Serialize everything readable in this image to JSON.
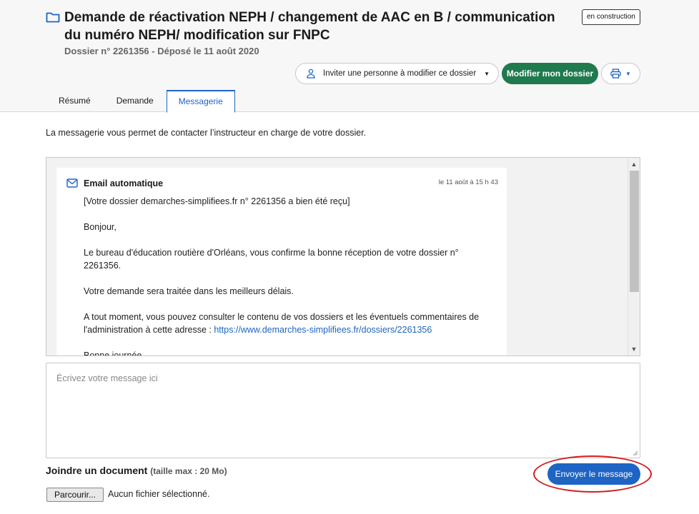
{
  "dossier": {
    "title": "Demande de réactivation NEPH / changement de AAC en B / communication du numéro NEPH/ modification sur FNPC",
    "subtitle": "Dossier n° 2261356 - Déposé le 11 août 2020",
    "status_badge": "en construction"
  },
  "actions": {
    "invite_label": "Inviter une personne à modifier ce dossier",
    "modify_label": "Modifier mon dossier"
  },
  "tabs": [
    {
      "label": "Résumé"
    },
    {
      "label": "Demande"
    },
    {
      "label": "Messagerie",
      "active": true
    }
  ],
  "intro": "La messagerie vous permet de contacter l’instructeur en charge de votre dossier.",
  "message": {
    "sender": "Email automatique",
    "date": "le 11 août à 15 h 43",
    "paragraphs": [
      "[Votre dossier demarches-simplifiees.fr n° 2261356 a bien été reçu]",
      "Bonjour,",
      "Le bureau d'éducation routière d'Orléans, vous confirme la bonne réception de votre dossier n° 2261356.",
      "Votre demande sera traitée dans les meilleurs délais."
    ],
    "access_text": "A tout moment, vous pouvez consulter le contenu de vos dossiers et les éventuels commentaires de l'administration à cette adresse : ",
    "access_link": "https://www.demarches-simplifiees.fr/dossiers/2261356",
    "closing": "Bonne journée,"
  },
  "composer": {
    "placeholder": "Écrivez votre message ici"
  },
  "attachment": {
    "label": "Joindre un document",
    "hint": "(taille max : 20 Mo)",
    "button": "Parcourir...",
    "status": "Aucun fichier sélectionné."
  },
  "send_label": "Envoyer le message",
  "colors": {
    "primary_blue": "#1d64c4",
    "green": "#1f7a4d",
    "highlight_red": "#d31f1f"
  },
  "icons": {
    "folder": "folder-icon",
    "person": "person-icon",
    "print": "printer-icon",
    "mail": "envelope-icon"
  }
}
